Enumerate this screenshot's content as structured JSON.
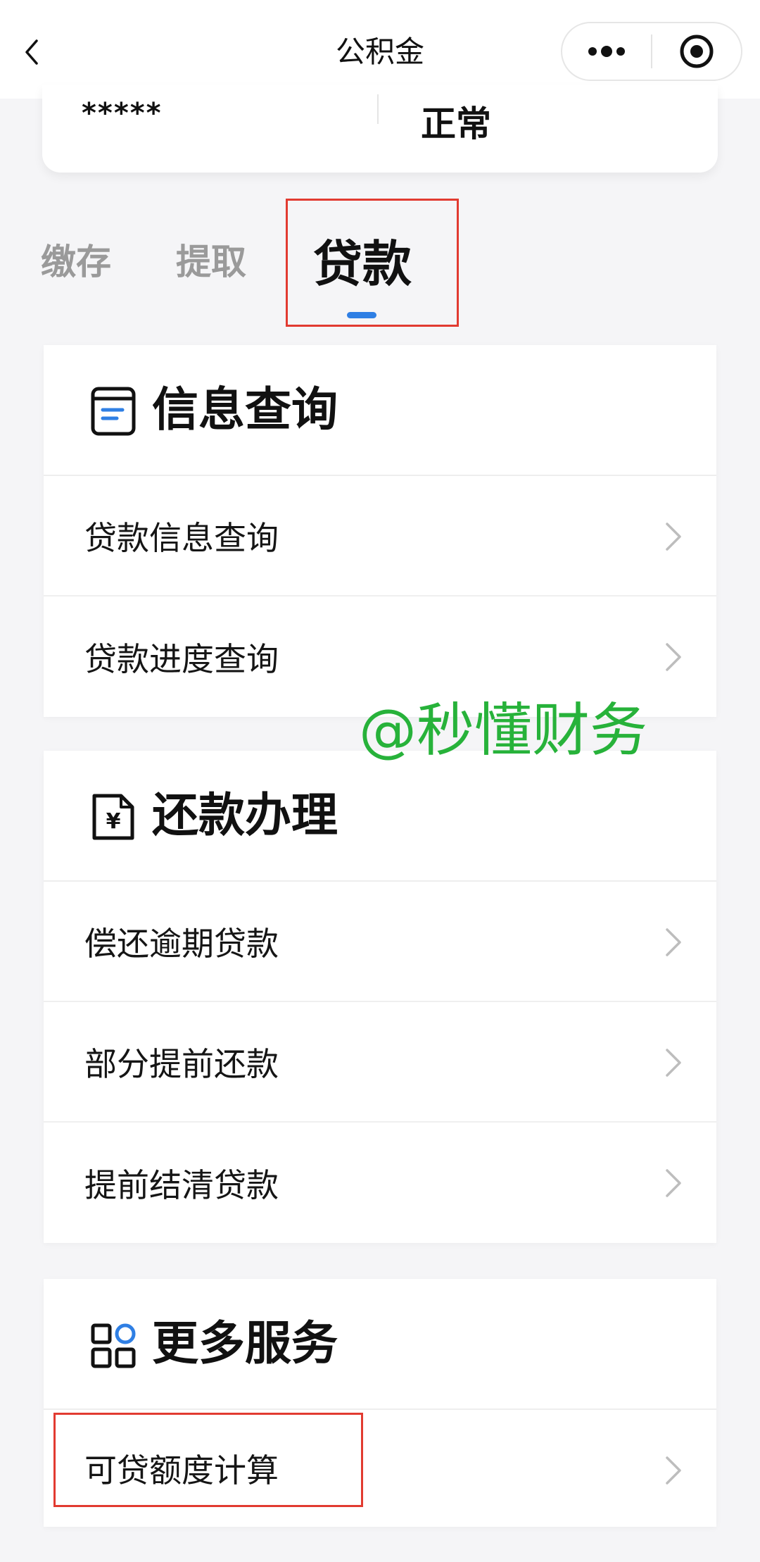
{
  "nav": {
    "title": "公积金",
    "back_icon": "chevron-left-icon",
    "more_icon": "more-dots-icon",
    "close_icon": "target-close-icon"
  },
  "account": {
    "masked_value": "*****",
    "status": "正常"
  },
  "tabs": [
    {
      "label": "缴存",
      "active": false
    },
    {
      "label": "提取",
      "active": false
    },
    {
      "label": "贷款",
      "active": true
    }
  ],
  "sections": [
    {
      "title": "信息查询",
      "icon": "document-list-icon",
      "items": [
        "贷款信息查询",
        "贷款进度查询"
      ]
    },
    {
      "title": "还款办理",
      "icon": "yuan-document-icon",
      "items": [
        "偿还逾期贷款",
        "部分提前还款",
        "提前结清贷款"
      ]
    },
    {
      "title": "更多服务",
      "icon": "grid-apps-icon",
      "items": [
        "可贷额度计算"
      ]
    }
  ],
  "watermark": "@秒懂财务",
  "colors": {
    "accent_blue": "#2f7fe4",
    "highlight_red": "#e23b31",
    "watermark_green": "#27b23a"
  }
}
